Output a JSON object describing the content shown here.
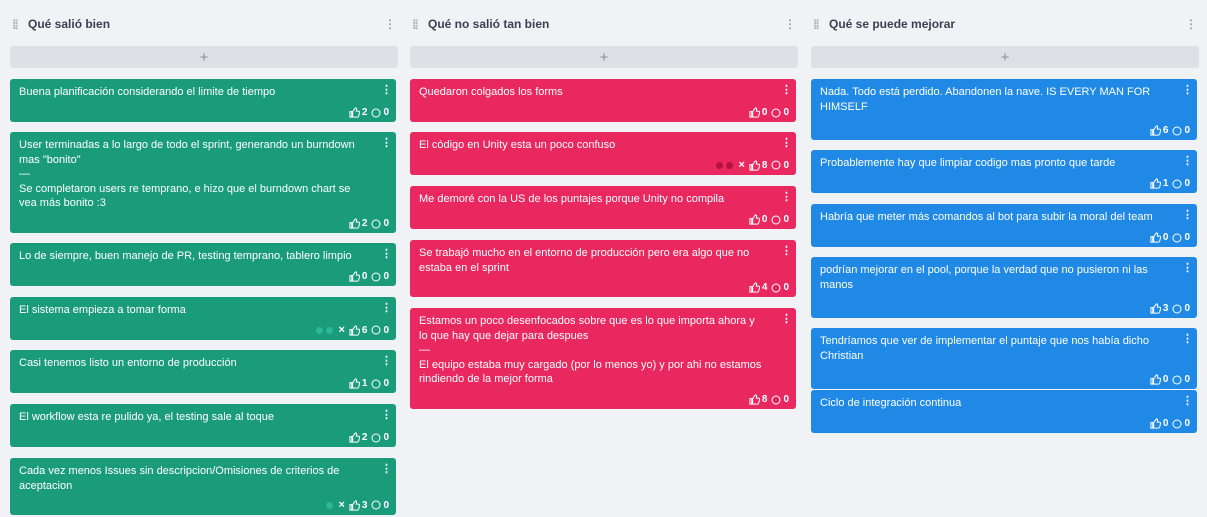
{
  "columns": [
    {
      "title": "Qué salió bien",
      "add_label": "+",
      "color": "#1a9c7b",
      "cards": [
        {
          "text": "Buena planificación considerando el limite de tiempo",
          "likes": "2",
          "comments": "0",
          "voters": []
        },
        {
          "text": "User terminadas a lo largo de todo el sprint, generando un burndown mas \"bonito\"\n—\nSe completaron users re temprano, e hizo que el burndown chart se vea más bonito :3",
          "likes": "2",
          "comments": "0",
          "voters": []
        },
        {
          "text": "Lo de siempre, buen manejo de PR, testing temprano, tablero limpio",
          "likes": "0",
          "comments": "0",
          "voters": []
        },
        {
          "text": "El sistema empieza a tomar forma",
          "likes": "6",
          "comments": "0",
          "voters": [
            "#2bb896",
            "#2bb896"
          ],
          "x": "×"
        },
        {
          "text": "Casi tenemos listo un entorno de producción",
          "likes": "1",
          "comments": "0",
          "voters": []
        },
        {
          "text": "El workflow esta re pulido ya, el testing sale al toque",
          "likes": "2",
          "comments": "0",
          "voters": []
        },
        {
          "text": "Cada vez menos Issues sin descripcion/Omisiones de criterios de aceptacion",
          "likes": "3",
          "comments": "0",
          "voters": [
            "#2bb896"
          ],
          "x": "×"
        }
      ]
    },
    {
      "title": "Qué no salió tan bien",
      "add_label": "+",
      "color": "#e8285e",
      "cards": [
        {
          "text": "Quedaron colgados los forms",
          "likes": "0",
          "comments": "0",
          "voters": []
        },
        {
          "text": "El código en Unity esta un poco confuso",
          "likes": "8",
          "comments": "0",
          "voters": [
            "#b8123f",
            "#b8123f"
          ],
          "x": "×"
        },
        {
          "text": "Me demoré con la US de los puntajes porque Unity no compila",
          "likes": "0",
          "comments": "0",
          "voters": []
        },
        {
          "text": "Se trabajó mucho en el entorno de producción pero era algo que no estaba en el sprint",
          "likes": "4",
          "comments": "0",
          "voters": []
        },
        {
          "text": "Estamos un poco desenfocados sobre que es lo que importa ahora y lo que hay que dejar para despues\n—\nEl equipo estaba muy cargado (por lo menos yo) y por ahi no estamos rindiendo de la mejor forma",
          "likes": "8",
          "comments": "0",
          "voters": []
        }
      ]
    },
    {
      "title": "Qué se puede mejorar",
      "add_label": "+",
      "color": "#2089e6",
      "cards": [
        {
          "text": "Nada. Todo está perdido. Abandonen la nave. IS EVERY MAN FOR HIMSELF",
          "likes": "6",
          "comments": "0",
          "voters": []
        },
        {
          "text": "Probablemente hay que limpiar codigo mas pronto que tarde",
          "likes": "1",
          "comments": "0",
          "voters": []
        },
        {
          "text": "Habría que meter más comandos al bot para subir la moral del team",
          "likes": "0",
          "comments": "0",
          "voters": []
        },
        {
          "text": "podrían mejorar en el pool, porque la verdad que no pusieron ni las manos",
          "likes": "3",
          "comments": "0",
          "voters": []
        },
        {
          "text": "Tendríamos que ver de implementar el puntaje que nos había dicho Christian",
          "likes": "0",
          "comments": "0",
          "voters": []
        },
        {
          "text": "Ciclo de integración continua",
          "likes": "0",
          "comments": "0",
          "voters": []
        }
      ]
    }
  ]
}
